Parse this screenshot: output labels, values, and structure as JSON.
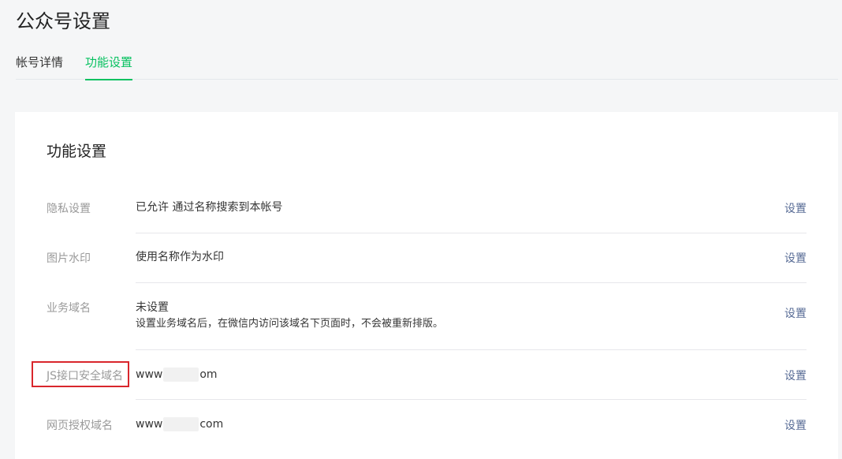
{
  "header": {
    "title": "公众号设置"
  },
  "tabs": [
    {
      "label": "帐号详情",
      "active": false
    },
    {
      "label": "功能设置",
      "active": true
    }
  ],
  "section": {
    "title": "功能设置"
  },
  "settings": [
    {
      "label": "隐私设置",
      "value": "已允许 通过名称搜索到本帐号",
      "action": "设置"
    },
    {
      "label": "图片水印",
      "value": "使用名称作为水印",
      "action": "设置"
    },
    {
      "label": "业务域名",
      "value": "未设置",
      "description": "设置业务域名后，在微信内访问该域名下页面时，不会被重新排版。",
      "action": "设置"
    },
    {
      "label": "JS接口安全域名",
      "value_prefix": "www",
      "value_suffix": "om",
      "action": "设置",
      "highlighted": true
    },
    {
      "label": "网页授权域名",
      "value_prefix": "www",
      "value_suffix": "com",
      "action": "设置"
    }
  ],
  "colors": {
    "accent": "#07c160",
    "link": "#576b95",
    "highlight_border": "#d9262c"
  }
}
